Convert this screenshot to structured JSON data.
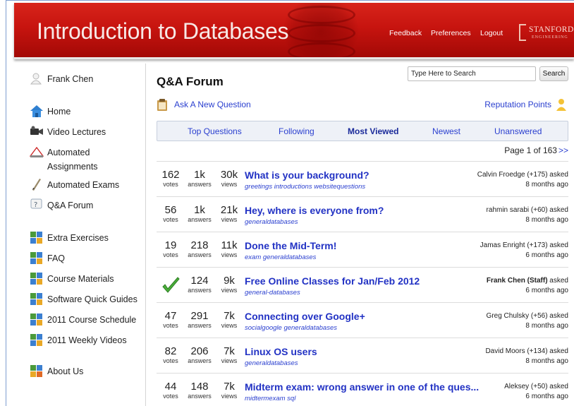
{
  "header": {
    "title": "Introduction to Databases",
    "nav": [
      "Feedback",
      "Preferences",
      "Logout"
    ],
    "logo_name": "STANFORD",
    "logo_sub": "ENGINEERING"
  },
  "sidebar": {
    "user": "Frank Chen",
    "items": [
      {
        "label": "Home",
        "icon": "home-icon"
      },
      {
        "label": "Video Lectures",
        "icon": "video-camera-icon"
      },
      {
        "label": "Automated Assignments",
        "icon": "assignment-icon"
      },
      {
        "label": "Automated Exams",
        "icon": "pencil-icon"
      },
      {
        "label": "Q&A Forum",
        "icon": "question-icon"
      },
      {
        "label": "Extra Exercises",
        "icon": "puzzle-icon"
      },
      {
        "label": "FAQ",
        "icon": "puzzle-icon"
      },
      {
        "label": "Course Materials",
        "icon": "puzzle-icon"
      },
      {
        "label": "Software Quick Guides",
        "icon": "puzzle-icon"
      },
      {
        "label": "2011 Course Schedule",
        "icon": "puzzle-icon"
      },
      {
        "label": "2011 Weekly Videos",
        "icon": "puzzle-icon"
      },
      {
        "label": "About Us",
        "icon": "puzzle-icon"
      }
    ]
  },
  "main": {
    "title": "Q&A Forum",
    "search_placeholder": "Type Here to Search",
    "search_button": "Search",
    "ask_label": "Ask A New Question",
    "reputation_label": "Reputation Points",
    "tabs": [
      "Top Questions",
      "Following",
      "Most Viewed",
      "Newest",
      "Unanswered"
    ],
    "active_tab": "Most Viewed",
    "pager": "Page 1 of 163",
    "pager_next": ">>",
    "stat_labels": {
      "votes": "votes",
      "answers": "answers",
      "views": "views"
    },
    "questions": [
      {
        "votes": "162",
        "answers": "1k",
        "views": "30k",
        "title": "What is your background?",
        "tags": "greetings introductions websitequestions",
        "author": "Calvin Froedge (+175) asked",
        "time": "8 months ago",
        "accepted": false
      },
      {
        "votes": "56",
        "answers": "1k",
        "views": "21k",
        "title": "Hey, where is everyone from?",
        "tags": "generaldatabases",
        "author": "rahmin sarabi (+60) asked",
        "time": "8 months ago",
        "accepted": false
      },
      {
        "votes": "19",
        "answers": "218",
        "views": "11k",
        "title": "Done the Mid-Term!",
        "tags": "exam generaldatabases",
        "author": "Jamas Enright (+173) asked",
        "time": "6 months ago",
        "accepted": false
      },
      {
        "votes": "",
        "answers": "124",
        "views": "9k",
        "title": "Free Online Classes for Jan/Feb 2012",
        "tags": "general-databases",
        "author_bold": "Frank Chen (Staff)",
        "author_rest": " asked",
        "time": "6 months ago",
        "accepted": true
      },
      {
        "votes": "47",
        "answers": "291",
        "views": "7k",
        "title": "Connecting over Google+",
        "tags": "socialgoogle generaldatabases",
        "author": "Greg Chulsky (+56) asked",
        "time": "8 months ago",
        "accepted": false
      },
      {
        "votes": "82",
        "answers": "206",
        "views": "7k",
        "title": "Linux OS users",
        "tags": "generaldatabases",
        "author": "David Moors (+134) asked",
        "time": "8 months ago",
        "accepted": false
      },
      {
        "votes": "44",
        "answers": "148",
        "views": "7k",
        "title": "Midterm exam: wrong answer in one of the ques...",
        "tags": "midtermexam sql",
        "author": "Aleksey (+50) asked",
        "time": "6 months ago",
        "accepted": false
      }
    ]
  },
  "colors": {
    "banner": "#c7140f",
    "link": "#2a3fcf",
    "title_link": "#2232c4"
  }
}
